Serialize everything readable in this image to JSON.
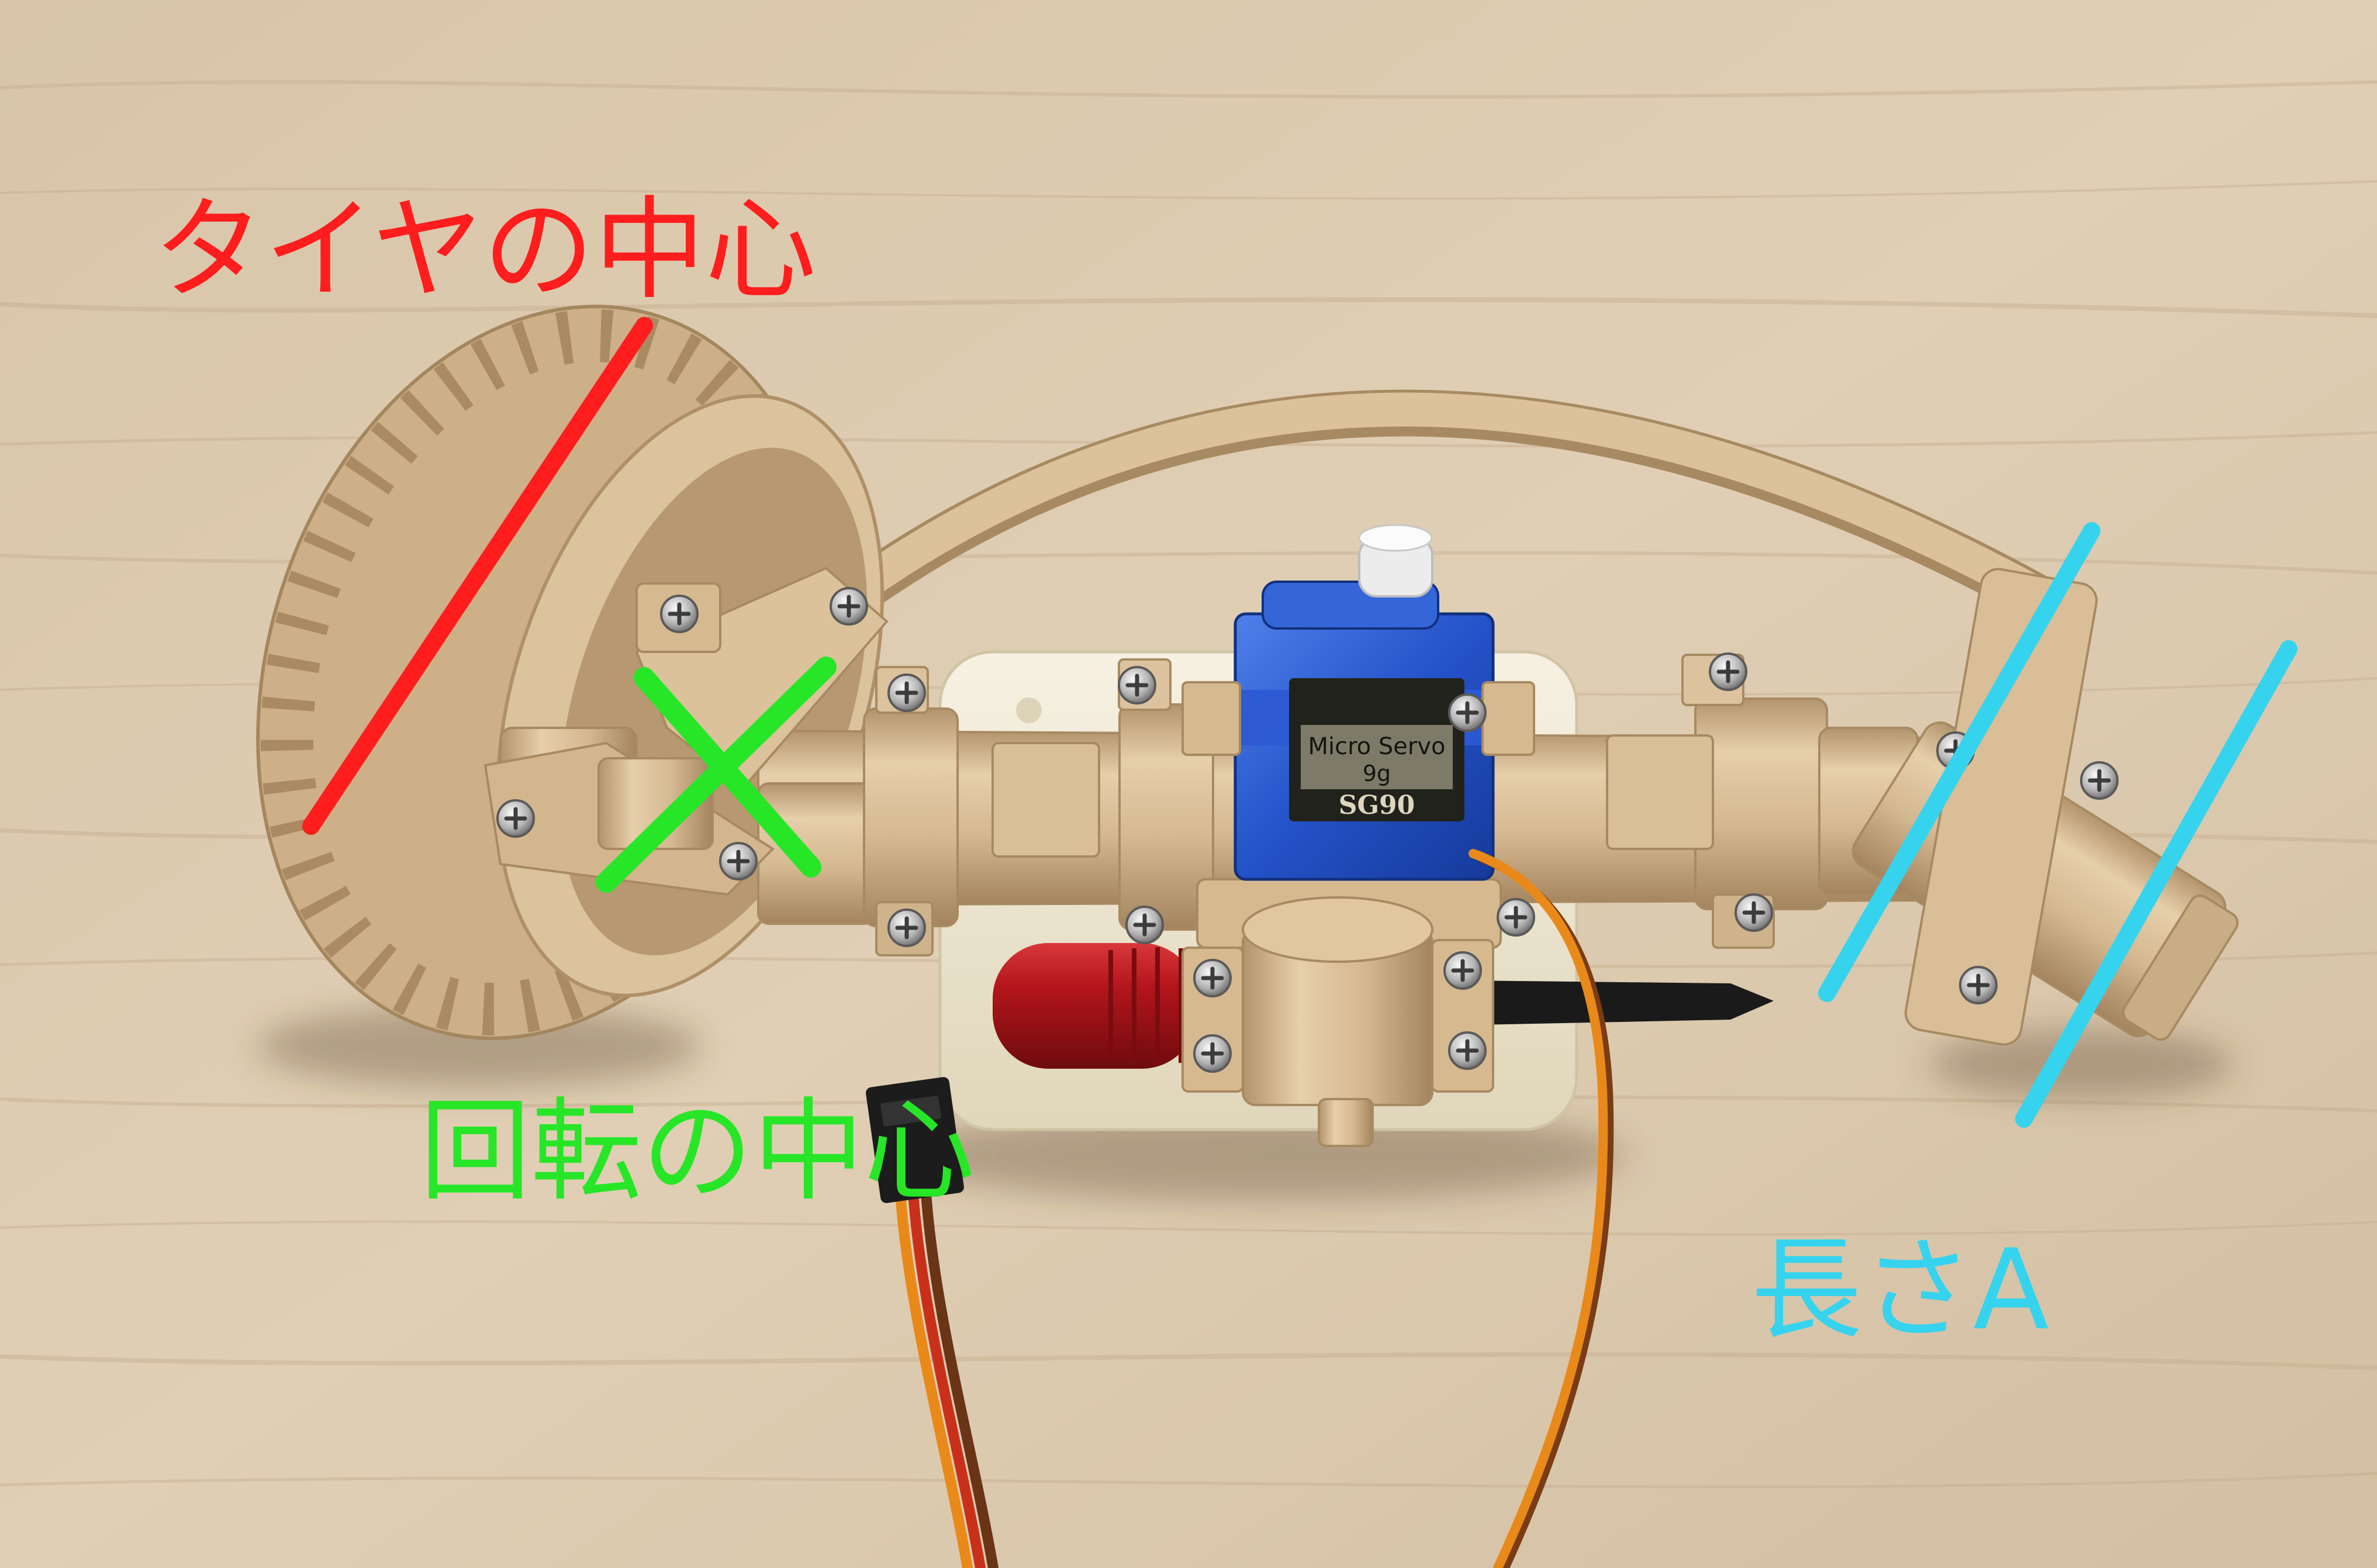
{
  "annotations": {
    "tire_center": {
      "label": "タイヤの中心",
      "color": "#ff1d1d"
    },
    "rotation_center": {
      "label": "回転の中心",
      "color": "#27e627"
    },
    "length_a": {
      "label": "長さA",
      "color": "#36d3ee"
    }
  },
  "servo": {
    "label_line1": "Micro Servo",
    "label_line2": "9g",
    "model": "SG90",
    "body_color": "#2c5ad4"
  },
  "colors": {
    "table": "#dccab0",
    "printed_part": "#d6b98f",
    "base_box": "#efe8d3",
    "handle": "#b3151b",
    "servo_wire": "#e8891a"
  }
}
